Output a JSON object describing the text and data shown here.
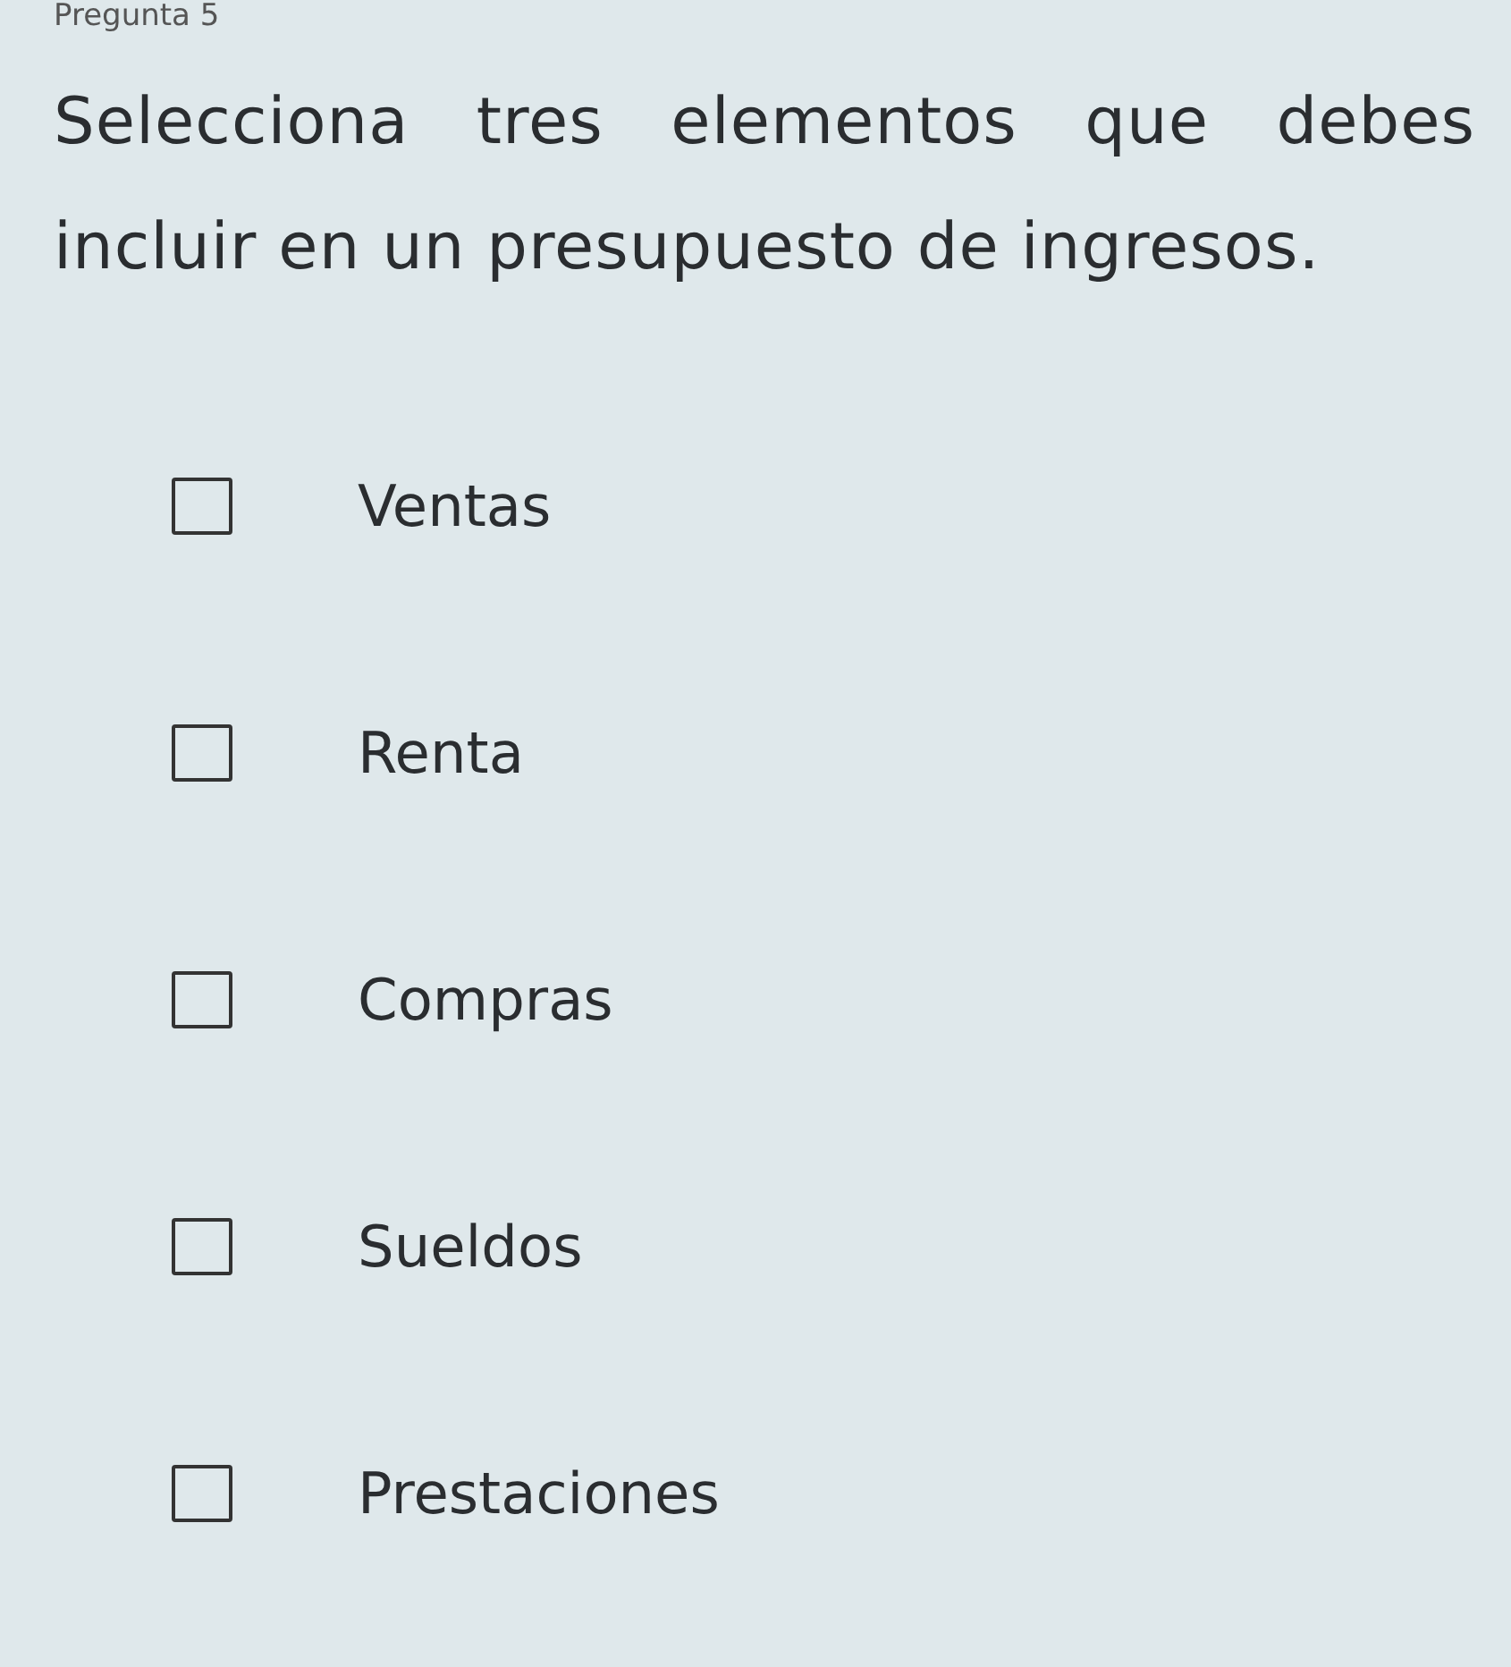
{
  "header": "Pregunta 5",
  "question": "Selecciona tres elementos que debes incluir en un presupuesto de ingresos.",
  "options": [
    {
      "label": "Ventas",
      "checked": false
    },
    {
      "label": "Renta",
      "checked": false
    },
    {
      "label": "Compras",
      "checked": false
    },
    {
      "label": "Sueldos",
      "checked": false
    },
    {
      "label": "Prestaciones",
      "checked": false
    }
  ]
}
